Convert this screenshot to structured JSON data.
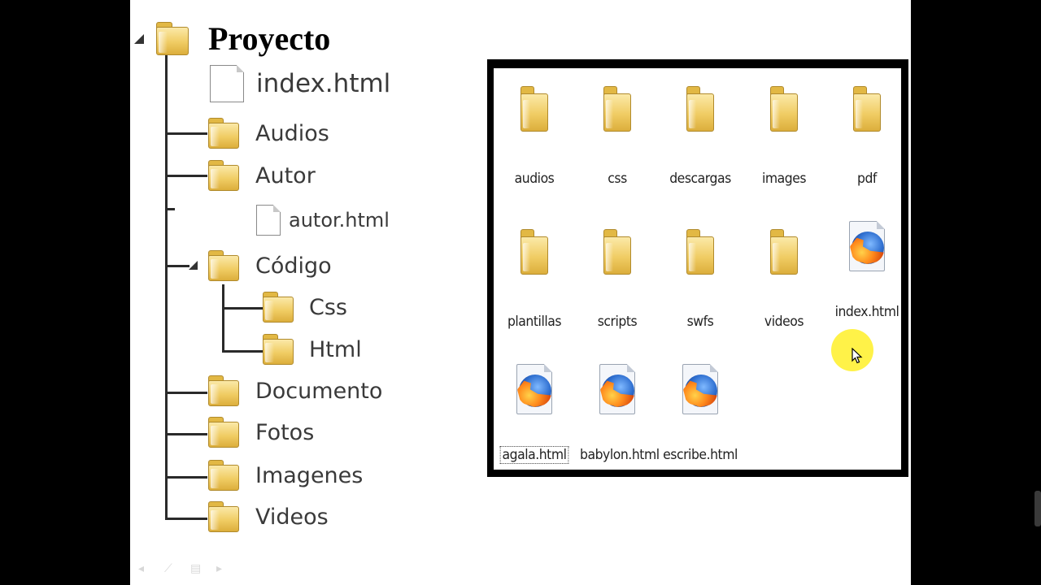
{
  "tree": {
    "root": {
      "label": "Proyecto",
      "icon": "folder-icon"
    },
    "children": [
      {
        "label": "index.html",
        "icon": "document-icon"
      },
      {
        "label": "Audios",
        "icon": "folder-icon"
      },
      {
        "label": "Autor",
        "icon": "folder-icon"
      },
      {
        "label": "autor.html",
        "icon": "document-icon"
      },
      {
        "label": "Código",
        "icon": "folder-icon"
      },
      {
        "label": "Css",
        "icon": "folder-icon"
      },
      {
        "label": "Html",
        "icon": "folder-icon"
      },
      {
        "label": "Documento",
        "icon": "folder-icon"
      },
      {
        "label": "Fotos",
        "icon": "folder-icon"
      },
      {
        "label": "Imagenes",
        "icon": "folder-icon"
      },
      {
        "label": "Videos",
        "icon": "folder-icon"
      }
    ]
  },
  "explorer": {
    "items": [
      {
        "name": "audios",
        "icon": "folder-icon"
      },
      {
        "name": "css",
        "icon": "folder-icon"
      },
      {
        "name": "descargas",
        "icon": "folder-icon"
      },
      {
        "name": "images",
        "icon": "folder-icon"
      },
      {
        "name": "pdf",
        "icon": "folder-icon"
      },
      {
        "name": "plantillas",
        "icon": "folder-icon"
      },
      {
        "name": "scripts",
        "icon": "folder-icon"
      },
      {
        "name": "swfs",
        "icon": "folder-icon"
      },
      {
        "name": "videos",
        "icon": "folder-icon"
      },
      {
        "name": "index.html",
        "icon": "firefox-html-icon"
      },
      {
        "name": "agala.html",
        "icon": "firefox-html-icon",
        "selected": true
      },
      {
        "name": "babylon.html",
        "icon": "firefox-html-icon"
      },
      {
        "name": "escribe.html",
        "icon": "firefox-html-icon"
      }
    ]
  },
  "colors": {
    "background": "#000000",
    "slide": "#ffffff",
    "folder": "#f0cc63",
    "cursor_highlight": "#fff028"
  }
}
